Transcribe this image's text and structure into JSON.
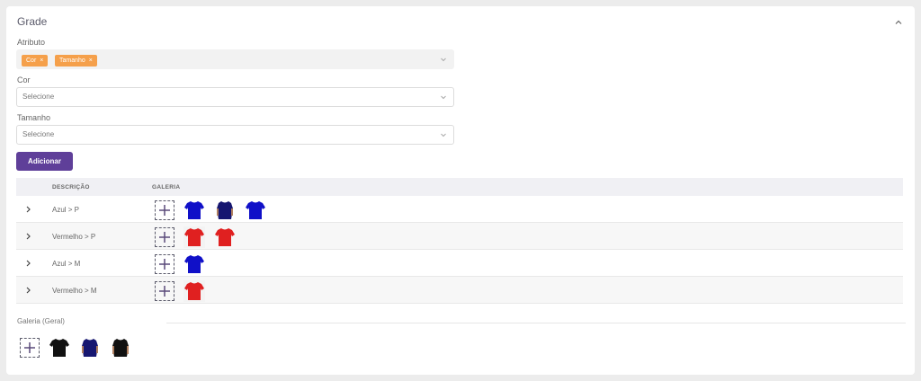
{
  "section": {
    "title": "Grade",
    "collapse_icon": "chevron-up-icon"
  },
  "atributo": {
    "label": "Atributo",
    "tags": [
      {
        "label": "Cor",
        "remove": "×"
      },
      {
        "label": "Tamanho",
        "remove": "×"
      }
    ]
  },
  "cor": {
    "label": "Cor",
    "placeholder": "Selecione"
  },
  "tamanho": {
    "label": "Tamanho",
    "placeholder": "Selecione"
  },
  "add_button": {
    "label": "Adicionar"
  },
  "table": {
    "headers": {
      "descricao": "DESCRIÇÃO",
      "galeria": "GALERIA"
    },
    "rows": [
      {
        "descricao": "Azul > P",
        "images": [
          "blue-shirt",
          "navy-shirt",
          "blue-shirt"
        ]
      },
      {
        "descricao": "Vermelho > P",
        "images": [
          "red-shirt",
          "red-shirt"
        ]
      },
      {
        "descricao": "Azul > M",
        "images": [
          "blue-shirt"
        ]
      },
      {
        "descricao": "Vermelho > M",
        "images": [
          "red-shirt"
        ]
      }
    ]
  },
  "general_gallery": {
    "label": "Galeria (Geral)",
    "images": [
      "black-shirt",
      "navy-shirt",
      "black-shirt"
    ]
  },
  "colors": {
    "accent": "#5f3f99",
    "tag": "#f5a04b",
    "blue_shirt": "#1010c8",
    "navy_shirt": "#161670",
    "red_shirt": "#e02020",
    "black_shirt": "#111111"
  }
}
